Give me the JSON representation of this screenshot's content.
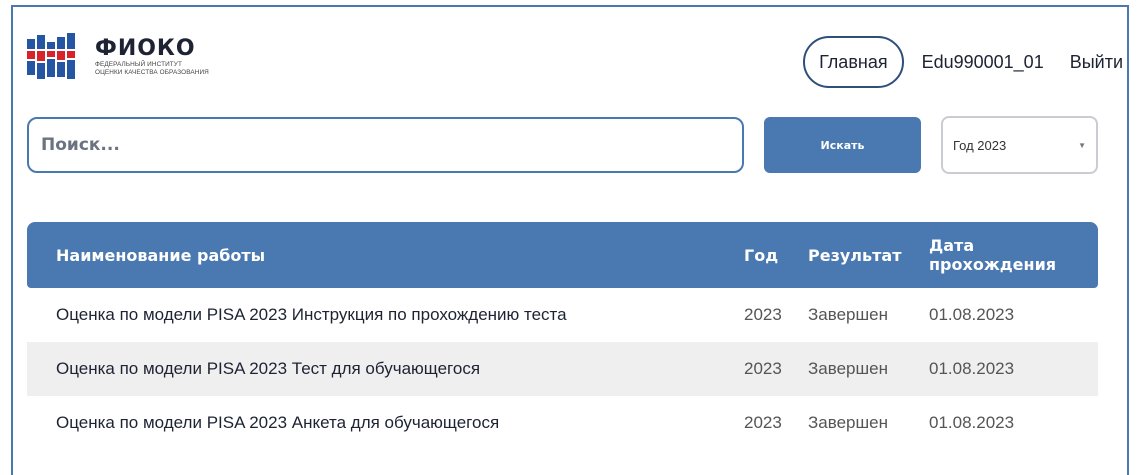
{
  "header": {
    "logo_title": "ФИОКО",
    "logo_subtitle_line1": "ФЕДЕРАЛЬНЫЙ ИНСТИТУТ",
    "logo_subtitle_line2": "ОЦЕНКИ КАЧЕСТВА ОБРАЗОВАНИЯ",
    "nav": {
      "home_label": "Главная",
      "user_label": "Edu990001_01",
      "logout_label": "Выйти"
    }
  },
  "search": {
    "placeholder": "Поиск...",
    "value": "",
    "button_label": "Искать",
    "year_select_value": "Год 2023"
  },
  "table": {
    "columns": [
      "Наименование работы",
      "Год",
      "Результат",
      "Дата прохождения"
    ],
    "date_header_line1": "Дата",
    "date_header_line2": "прохождения",
    "rows": [
      {
        "name": "Оценка по модели PISA 2023 Инструкция по прохождению теста",
        "year": "2023",
        "result": "Завершен",
        "date": "01.08.2023"
      },
      {
        "name": "Оценка по модели PISA 2023 Тест для обучающегося",
        "year": "2023",
        "result": "Завершен",
        "date": "01.08.2023"
      },
      {
        "name": "Оценка по модели PISA 2023 Анкета для обучающегося",
        "year": "2023",
        "result": "Завершен",
        "date": "01.08.2023"
      }
    ]
  },
  "colors": {
    "accent": "#4a78b0",
    "logo_blue": "#2456a4",
    "logo_red": "#d8232a",
    "row_alt": "#efefef"
  },
  "icons": {
    "logo": "fioko-logo-icon",
    "select_caret": "caret-down-icon"
  }
}
